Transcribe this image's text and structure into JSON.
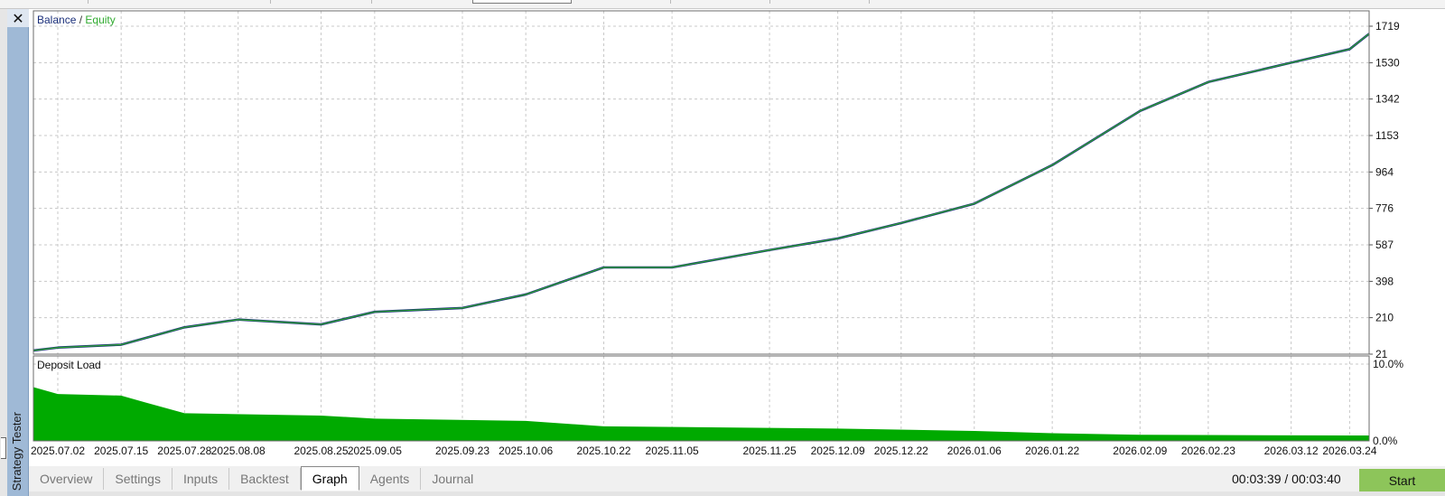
{
  "window": {
    "panel_title": "Strategy Tester"
  },
  "tabs": [
    {
      "label": "Overview",
      "active": false
    },
    {
      "label": "Settings",
      "active": false
    },
    {
      "label": "Inputs",
      "active": false
    },
    {
      "label": "Backtest",
      "active": false
    },
    {
      "label": "Graph",
      "active": true
    },
    {
      "label": "Agents",
      "active": false
    },
    {
      "label": "Journal",
      "active": false
    }
  ],
  "status": {
    "timer": "00:03:39 / 00:03:40"
  },
  "actions": {
    "start_label": "Start"
  },
  "colors": {
    "balance": "#1a2f7a",
    "equity": "#2faa2f",
    "deposit_load": "#00aa00",
    "grid": "#c8c8c8"
  },
  "chart_data": [
    {
      "type": "line",
      "legend": {
        "balance": "Balance",
        "separator": " / ",
        "equity": "Equity",
        "placement": "top-left"
      },
      "y_ticks": [
        "1719",
        "1530",
        "1342",
        "1153",
        "964",
        "776",
        "587",
        "398",
        "210",
        "21"
      ],
      "ylim": [
        21,
        1719
      ],
      "grid": true,
      "x": [
        "2025.06.27",
        "2025.07.02",
        "2025.07.15",
        "2025.07.28",
        "2025.08.08",
        "2025.08.25",
        "2025.09.05",
        "2025.09.23",
        "2025.10.06",
        "2025.10.22",
        "2025.11.05",
        "2025.11.25",
        "2025.12.09",
        "2025.12.22",
        "2026.01.06",
        "2026.01.22",
        "2026.02.09",
        "2026.02.23",
        "2026.03.12",
        "2026.03.24",
        "2026.03.28"
      ],
      "series": [
        {
          "name": "Balance",
          "values": [
            40,
            55,
            70,
            160,
            200,
            175,
            240,
            260,
            330,
            470,
            470,
            560,
            620,
            700,
            800,
            1000,
            1280,
            1430,
            1530,
            1600,
            1680
          ]
        },
        {
          "name": "Equity",
          "values": [
            40,
            55,
            70,
            160,
            200,
            175,
            240,
            260,
            330,
            470,
            470,
            560,
            620,
            700,
            800,
            1000,
            1280,
            1430,
            1530,
            1600,
            1680
          ]
        }
      ]
    },
    {
      "type": "area",
      "title": "Deposit Load",
      "y_ticks": [
        "10.0%",
        "0.0%"
      ],
      "ylim": [
        0,
        10
      ],
      "grid": true,
      "x_ticks": [
        "2025.07.02",
        "2025.07.15",
        "2025.07.28",
        "2025.08.08",
        "2025.08.25",
        "2025.09.05",
        "2025.09.23",
        "2025.10.06",
        "2025.10.22",
        "2025.11.05",
        "2025.11.25",
        "2025.12.09",
        "2025.12.22",
        "2026.01.06",
        "2026.01.22",
        "2026.02.09",
        "2026.02.23",
        "2026.03.12",
        "2026.03.24"
      ],
      "x": [
        "2025.06.27",
        "2025.07.02",
        "2025.07.15",
        "2025.07.20",
        "2025.07.28",
        "2025.08.25",
        "2025.09.05",
        "2025.10.06",
        "2025.10.22",
        "2025.12.09",
        "2026.01.06",
        "2026.01.22",
        "2026.02.09",
        "2026.03.24",
        "2026.03.28"
      ],
      "series": [
        {
          "name": "Deposit Load",
          "values": [
            7.0,
            6.1,
            5.9,
            5.0,
            3.6,
            3.3,
            2.9,
            2.6,
            1.9,
            1.6,
            1.3,
            1.0,
            0.8,
            0.7,
            0.7
          ]
        }
      ]
    }
  ]
}
